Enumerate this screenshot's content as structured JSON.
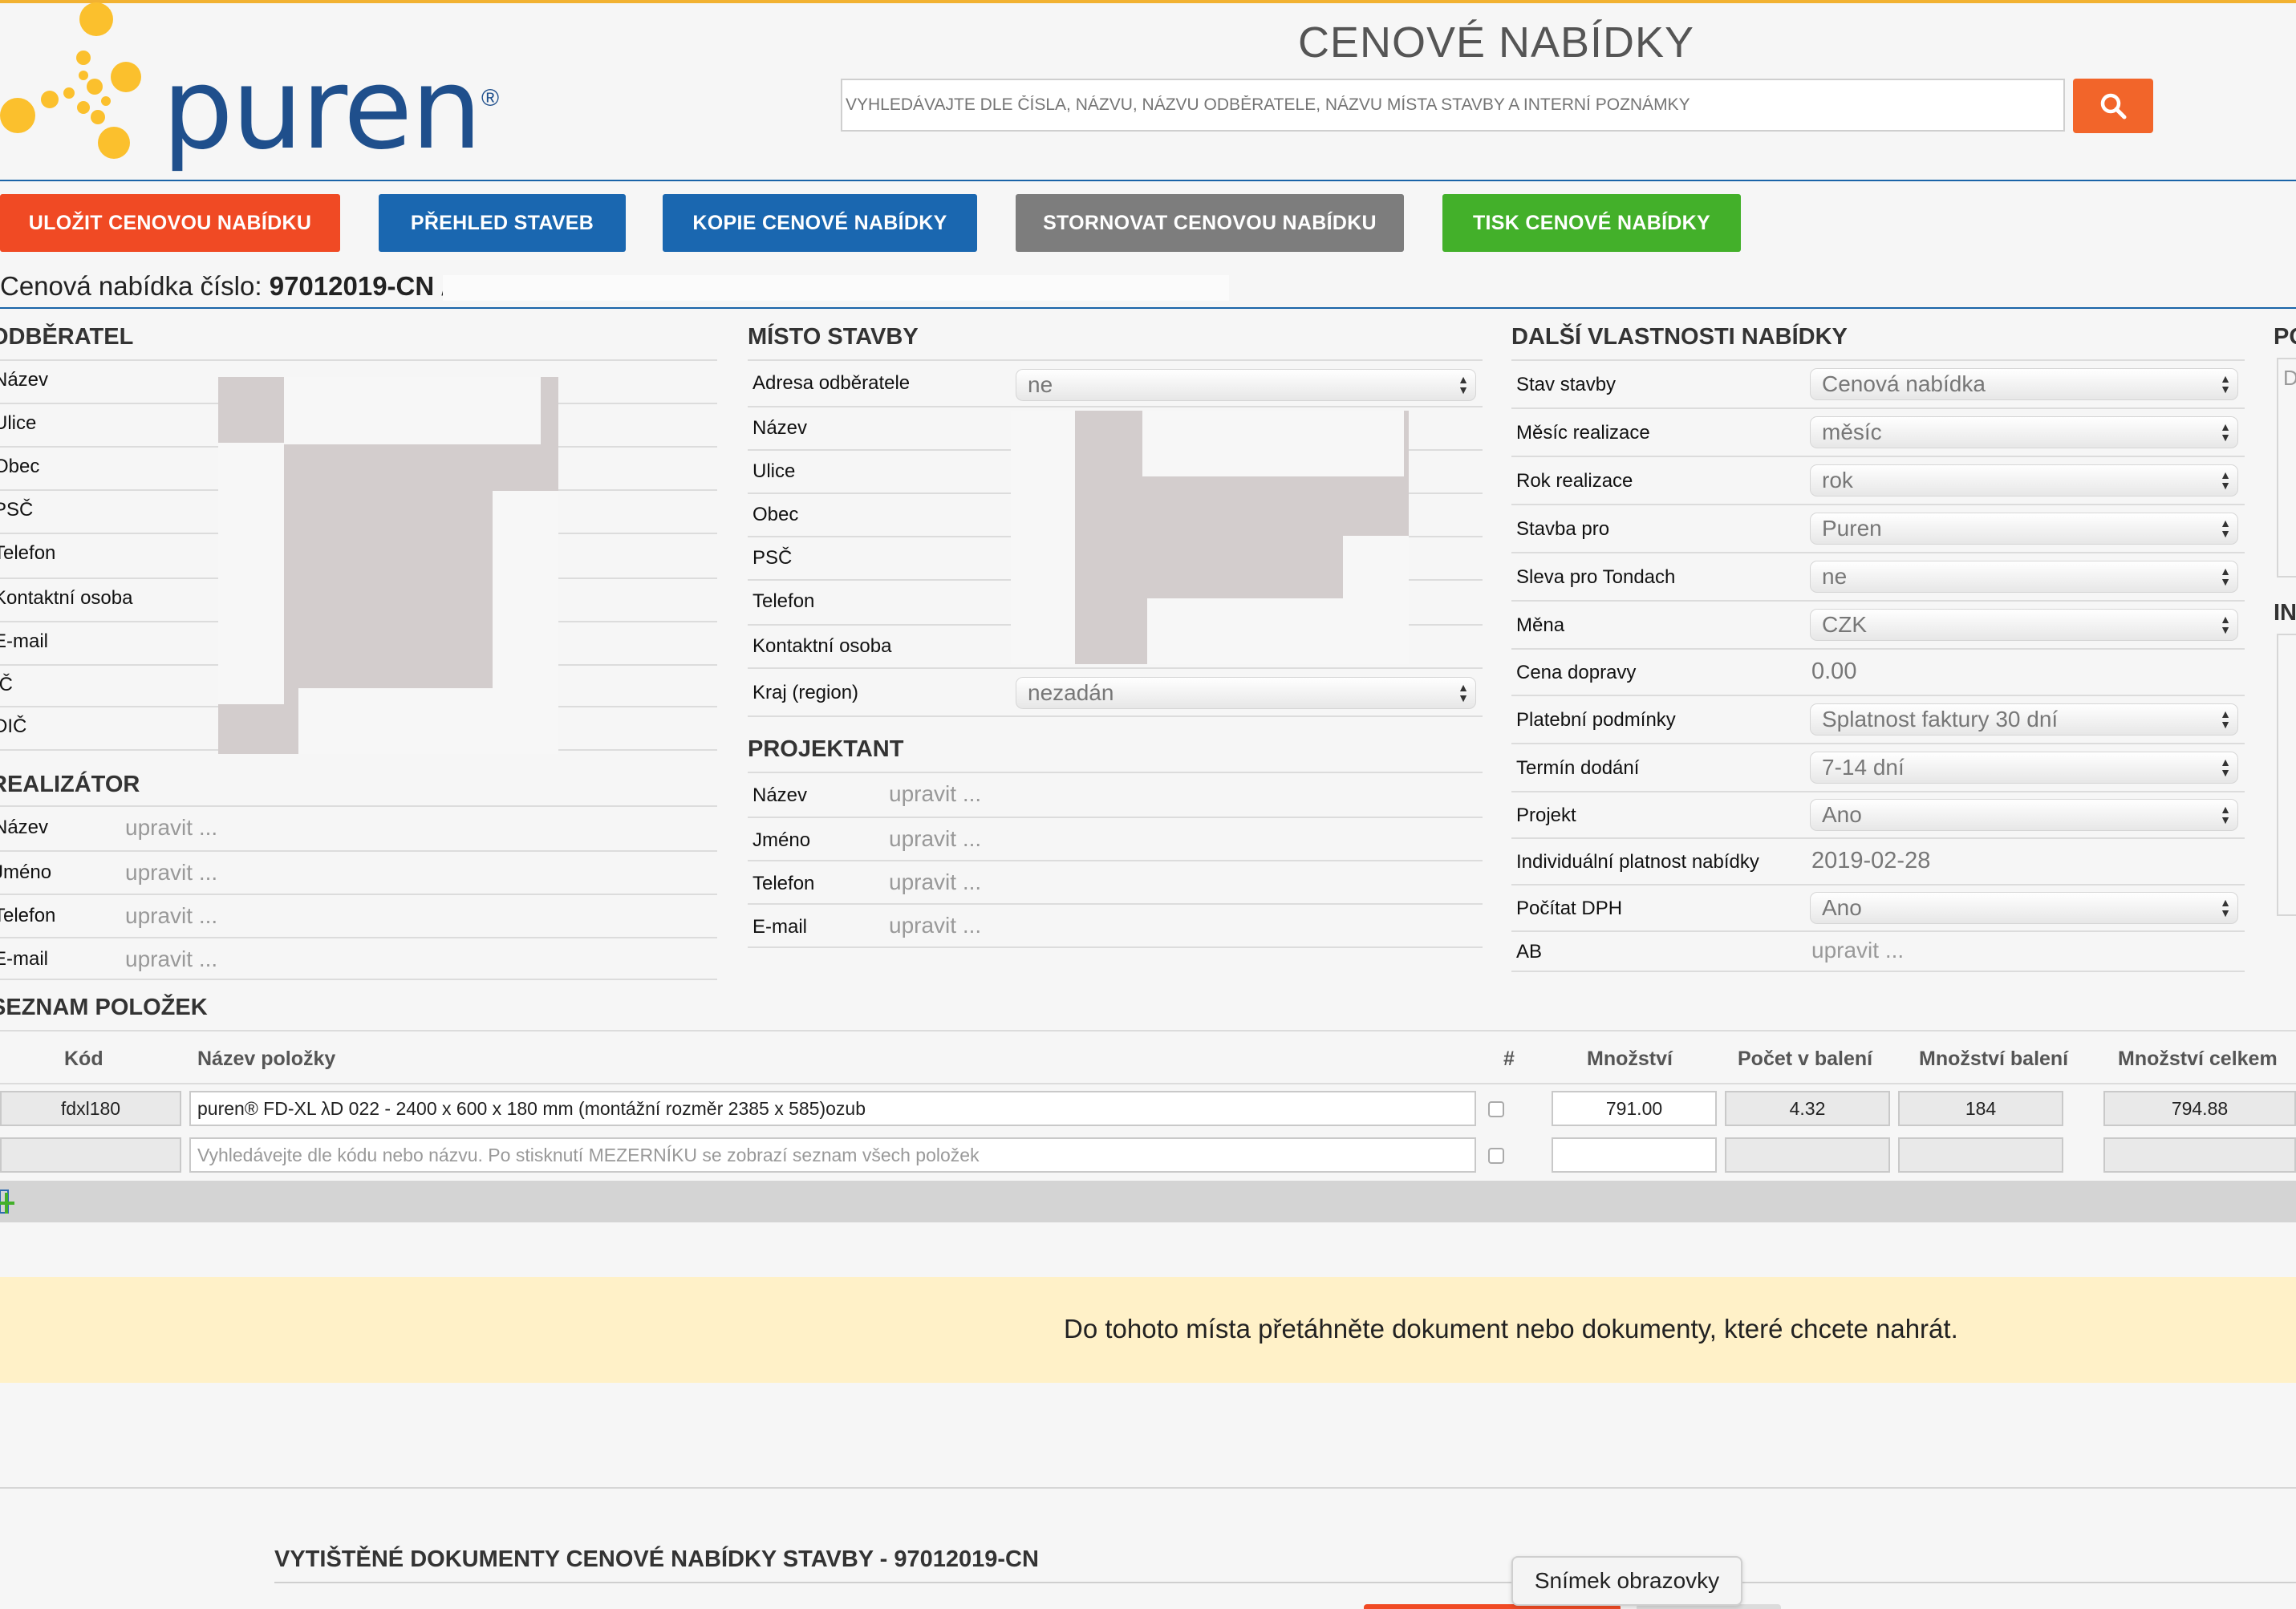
{
  "header": {
    "logo_text": "puren",
    "logo_mark": "®",
    "title": "CENOVÉ NABÍDKY",
    "search_placeholder": "VYHLEDÁVAJTE DLE ČÍSLA, NÁZVU, NÁZVU ODBĚRATELE, NÁZVU MÍSTA STAVBY A INTERNÍ POZNÁMKY",
    "search_icon": "search-icon"
  },
  "toolbar": {
    "buttons": [
      {
        "label": "ULOŽIT CENOVOU NABÍDKU",
        "color": "#f04a24"
      },
      {
        "label": "PŘEHLED STAVEB",
        "color": "#1a67b0"
      },
      {
        "label": "KOPIE CENOVÉ NABÍDKY",
        "color": "#1a67b0"
      },
      {
        "label": "STORNOVAT CENOVOU NABÍDKU",
        "color": "#7d7d7d"
      },
      {
        "label": "TISK CENOVÉ NABÍDKY",
        "color": "#43b02a"
      }
    ]
  },
  "offer": {
    "prefix": "Cenová nabídka číslo: ",
    "number": "97012019-CN",
    "separator": " /"
  },
  "odberatel": {
    "title": "ODBĚRATEL",
    "rows": [
      "Název",
      "Ulice",
      "Obec",
      "PSČ",
      "Telefon",
      "Kontaktní osoba",
      "E-mail",
      "IČ",
      "DIČ"
    ]
  },
  "realizator": {
    "title": "REALIZÁTOR",
    "rows": [
      {
        "label": "Název",
        "value": "upravit ..."
      },
      {
        "label": "Jméno",
        "value": "upravit ..."
      },
      {
        "label": "Telefon",
        "value": "upravit ..."
      },
      {
        "label": "E-mail",
        "value": "upravit ..."
      }
    ]
  },
  "misto": {
    "title": "MÍSTO STAVBY",
    "adresa_label": "Adresa odběratele",
    "adresa_value": "ne",
    "rows": [
      "Název",
      "Ulice",
      "Obec",
      "PSČ",
      "Telefon",
      "Kontaktní osoba"
    ],
    "kraj_label": "Kraj (region)",
    "kraj_value": "nezadán"
  },
  "projektant": {
    "title": "PROJEKTANT",
    "rows": [
      {
        "label": "Název",
        "value": "upravit ..."
      },
      {
        "label": "Jméno",
        "value": "upravit ..."
      },
      {
        "label": "Telefon",
        "value": "upravit ..."
      },
      {
        "label": "E-mail",
        "value": "upravit ..."
      }
    ]
  },
  "vlastnosti": {
    "title": "DALŠÍ VLASTNOSTI NABÍDKY",
    "rows": [
      {
        "label": "Stav stavby",
        "value": "Cenová nabídka",
        "type": "select"
      },
      {
        "label": "Měsíc realizace",
        "value": "měsíc",
        "type": "select"
      },
      {
        "label": "Rok realizace",
        "value": "rok",
        "type": "select"
      },
      {
        "label": "Stavba pro",
        "value": "Puren",
        "type": "select"
      },
      {
        "label": "Sleva pro Tondach",
        "value": "ne",
        "type": "select"
      },
      {
        "label": "Měna",
        "value": "CZK",
        "type": "select"
      },
      {
        "label": "Cena dopravy",
        "value": "0.00",
        "type": "text"
      },
      {
        "label": "Platební podmínky",
        "value": "Splatnost faktury 30 dní",
        "type": "select"
      },
      {
        "label": "Termín dodání",
        "value": "7-14 dní",
        "type": "select"
      },
      {
        "label": "Projekt",
        "value": "Ano",
        "type": "select"
      },
      {
        "label": "Individuální platnost nabídky",
        "value": "2019-02-28",
        "type": "text"
      },
      {
        "label": "Počítat DPH",
        "value": "Ano",
        "type": "select"
      },
      {
        "label": "AB",
        "value": "upravit ...",
        "type": "edit"
      }
    ]
  },
  "right_partial": {
    "head1": "PO",
    "cell1": "D",
    "head2": "IN"
  },
  "items": {
    "title": "SEZNAM POLOŽEK",
    "columns": [
      "Kód",
      "Název položky",
      "#",
      "Množství",
      "Počet v balení",
      "Množství balení",
      "Množství celkem"
    ],
    "rows": [
      {
        "kod": "fdxl180",
        "nazev": "puren® FD-XL λD 022 - 2400 x 600 x 180 mm (montážní rozměr 2385 x 585)ozub",
        "mnozstvi": "791.00",
        "pocet": "4.32",
        "baleni": "184",
        "celkem": "794.88"
      }
    ],
    "new_row_placeholder": "Vyhledávejte dle kódu nebo názvu. Po stisknutí MEZERNÍKU se zobrazí seznam všech položek",
    "add_icon": "plus-icon"
  },
  "dropzone": {
    "text": "Do tohoto místa přetáhněte dokument nebo dokumenty, které chcete nahrát."
  },
  "printed": {
    "title": "VYTIŠTĚNÉ DOKUMENTY CENOVÉ NABÍDKY STAVBY - 97012019-CN"
  },
  "tooltip": {
    "text": "Snímek obrazovky"
  }
}
